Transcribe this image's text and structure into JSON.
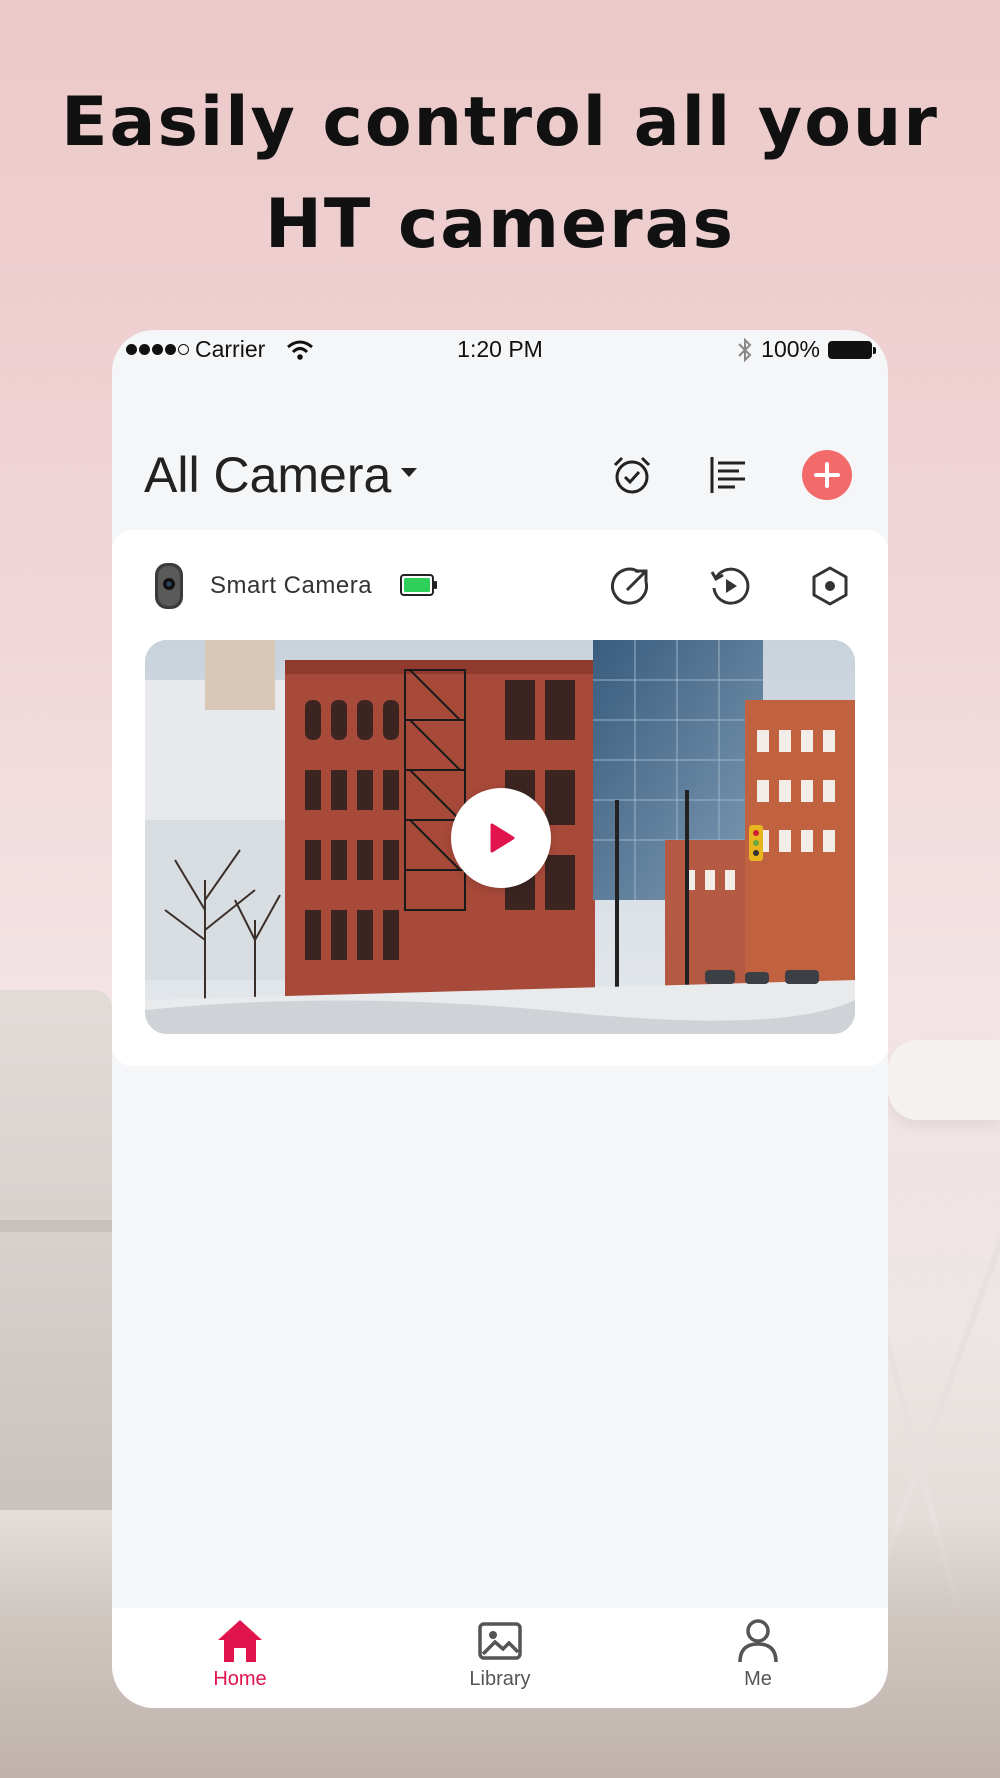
{
  "headline": {
    "line1": "Easily control all your",
    "line2": "HT cameras"
  },
  "statusbar": {
    "carrier": "Carrier",
    "time": "1:20 PM",
    "battery": "100%"
  },
  "header": {
    "title": "All Camera",
    "icons": [
      "alarm-clock-icon",
      "list-icon",
      "add-icon"
    ]
  },
  "camera_card": {
    "name": "Smart Camera",
    "battery_color": "#2fd05a",
    "actions": [
      "share-icon",
      "playback-icon",
      "settings-icon"
    ]
  },
  "tabs": [
    {
      "label": "Home",
      "icon": "home-icon",
      "active": true
    },
    {
      "label": "Library",
      "icon": "image-icon",
      "active": false
    },
    {
      "label": "Me",
      "icon": "user-icon",
      "active": false
    }
  ],
  "colors": {
    "accent": "#e0154d",
    "add_button": "#f36a6a",
    "inactive": "#555555"
  }
}
